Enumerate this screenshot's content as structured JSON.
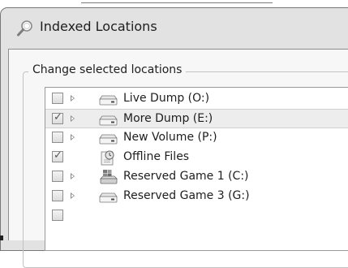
{
  "window": {
    "title": "Indexed Locations",
    "title_icon": "search-magnifier-icon"
  },
  "group": {
    "label": "Change selected locations"
  },
  "locations": [
    {
      "label": "Live Dump (O:)",
      "checked": false,
      "has_expander": true,
      "icon": "drive-icon",
      "selected": false
    },
    {
      "label": "More Dump (E:)",
      "checked": true,
      "has_expander": true,
      "icon": "drive-icon",
      "selected": true
    },
    {
      "label": "New Volume (P:)",
      "checked": false,
      "has_expander": true,
      "icon": "drive-icon",
      "selected": false
    },
    {
      "label": "Offline Files",
      "checked": true,
      "has_expander": false,
      "icon": "offline-files-icon",
      "selected": false
    },
    {
      "label": "Reserved Game 1 (C:)",
      "checked": false,
      "has_expander": true,
      "icon": "system-drive-icon",
      "selected": false
    },
    {
      "label": "Reserved Game 3 (G:)",
      "checked": false,
      "has_expander": true,
      "icon": "drive-icon",
      "selected": false
    }
  ],
  "colors": {
    "window_bg": "#e2e2e2",
    "client_bg": "#f7f7f7",
    "selection_bg": "#ededed"
  }
}
